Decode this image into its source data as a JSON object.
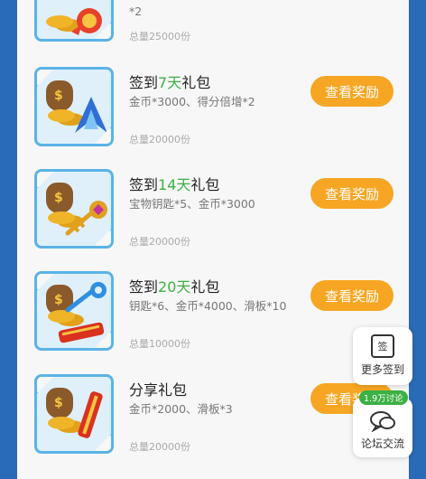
{
  "items": [
    {
      "title_pre": "",
      "title_hl": "",
      "title_post": "",
      "desc": "*2",
      "total": "总量25000份",
      "button": ""
    },
    {
      "title_pre": "签到",
      "title_hl": "7天",
      "title_post": "礼包",
      "desc": "金币*3000、得分倍增*2",
      "total": "总量20000份",
      "button": "查看奖励"
    },
    {
      "title_pre": "签到",
      "title_hl": "14天",
      "title_post": "礼包",
      "desc": "宝物钥匙*5、金币*3000",
      "total": "总量20000份",
      "button": "查看奖励"
    },
    {
      "title_pre": "签到",
      "title_hl": "20天",
      "title_post": "礼包",
      "desc": "钥匙*6、金币*4000、滑板*10",
      "total": "总量10000份",
      "button": "查看奖励"
    },
    {
      "title_pre": "分享礼包",
      "title_hl": "",
      "title_post": "",
      "desc": "金币*2000、滑板*3",
      "total": "总量20000份",
      "button": "查看奖励"
    }
  ],
  "float_signin": {
    "icon_text": "签",
    "label": "更多签到"
  },
  "float_forum": {
    "badge": "1.9万讨论",
    "label": "论坛交流"
  },
  "colors": {
    "accent": "#f6a623",
    "highlight": "#3cb043",
    "background": "#2a6bb8"
  }
}
